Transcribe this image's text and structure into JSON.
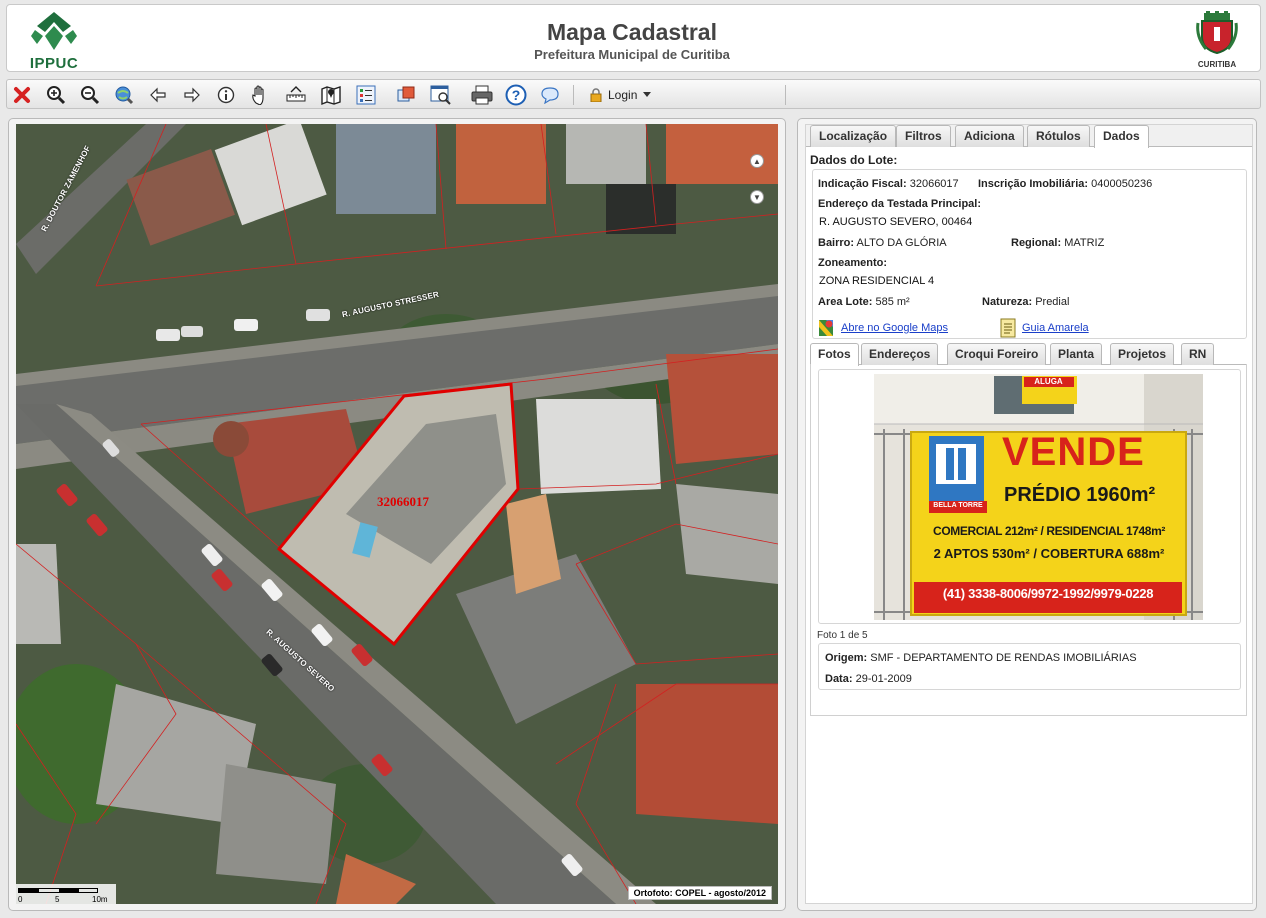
{
  "header": {
    "logo_left": "IPPUC",
    "title": "Mapa Cadastral",
    "subtitle": "Prefeitura Municipal de Curitiba",
    "logo_right": "CURITIBA"
  },
  "toolbar": {
    "tools": [
      "close-icon",
      "zoom-in-icon",
      "zoom-out-icon",
      "full-extent-icon",
      "previous-view-icon",
      "next-view-icon",
      "info-icon",
      "pan-hand-icon",
      "measure-icon",
      "map-layers-icon",
      "legend-icon",
      "copy-icon",
      "search-window-icon",
      "print-icon",
      "help-icon",
      "comment-icon"
    ],
    "login_label": "Login"
  },
  "map": {
    "streets": [
      "R. DOUTOR ZAMENHOF",
      "R. AUGUSTO STRESSER",
      "R. AUGUSTO SEVERO"
    ],
    "lot_label": "32066017",
    "scale_labels": [
      "0",
      "5",
      "10m"
    ],
    "attribution": "Ortofoto: COPEL - agosto/2012"
  },
  "panel": {
    "tabs": [
      "Localização",
      "Filtros",
      "Adiciona",
      "Rótulos",
      "Dados"
    ],
    "active_tab": "Dados",
    "section_title": "Dados do Lote:",
    "fields": {
      "indicacao_fiscal_label": "Indicação Fiscal:",
      "indicacao_fiscal": "32066017",
      "inscricao_label": "Inscrição Imobiliária:",
      "inscricao": "0400050236",
      "endereco_label": "Endereço da Testada Principal:",
      "endereco": "R. AUGUSTO SEVERO, 00464",
      "bairro_label": "Bairro:",
      "bairro": "ALTO DA GLÓRIA",
      "regional_label": "Regional:",
      "regional": "MATRIZ",
      "zoneamento_label": "Zoneamento:",
      "zoneamento": "ZONA RESIDENCIAL 4",
      "area_label": "Area Lote:",
      "area": "585 m²",
      "natureza_label": "Natureza:",
      "natureza": "Predial"
    },
    "links": {
      "google_maps": "Abre no Google Maps",
      "guia_amarela": "Guia Amarela"
    },
    "sub_tabs": [
      "Fotos",
      "Endereços",
      "Croqui Foreiro",
      "Planta",
      "Projetos",
      "RN"
    ],
    "active_sub_tab": "Fotos",
    "photo": {
      "sign_small": "ALUGA",
      "brand": "BELLA TORRE",
      "sign_title": "VENDE",
      "line1": "PRÉDIO 1960m²",
      "line2": "COMERCIAL 212m² / RESIDENCIAL 1748m²",
      "line3": "2 APTOS 530m² / COBERTURA 688m²",
      "phones": "(41) 3338-8006/9972-1992/9979-0228",
      "caption": "Foto 1 de 5"
    },
    "meta": {
      "origem_label": "Origem:",
      "origem": "SMF - DEPARTAMENTO DE RENDAS IMOBILIÁRIAS",
      "data_label": "Data:",
      "data": "29-01-2009"
    }
  },
  "colors": {
    "brand_green": "#1f6f3d",
    "lot_outline": "#e00000",
    "link": "#1a3fc9",
    "sign_yellow": "#f4d31a",
    "sign_red": "#d7231b"
  }
}
